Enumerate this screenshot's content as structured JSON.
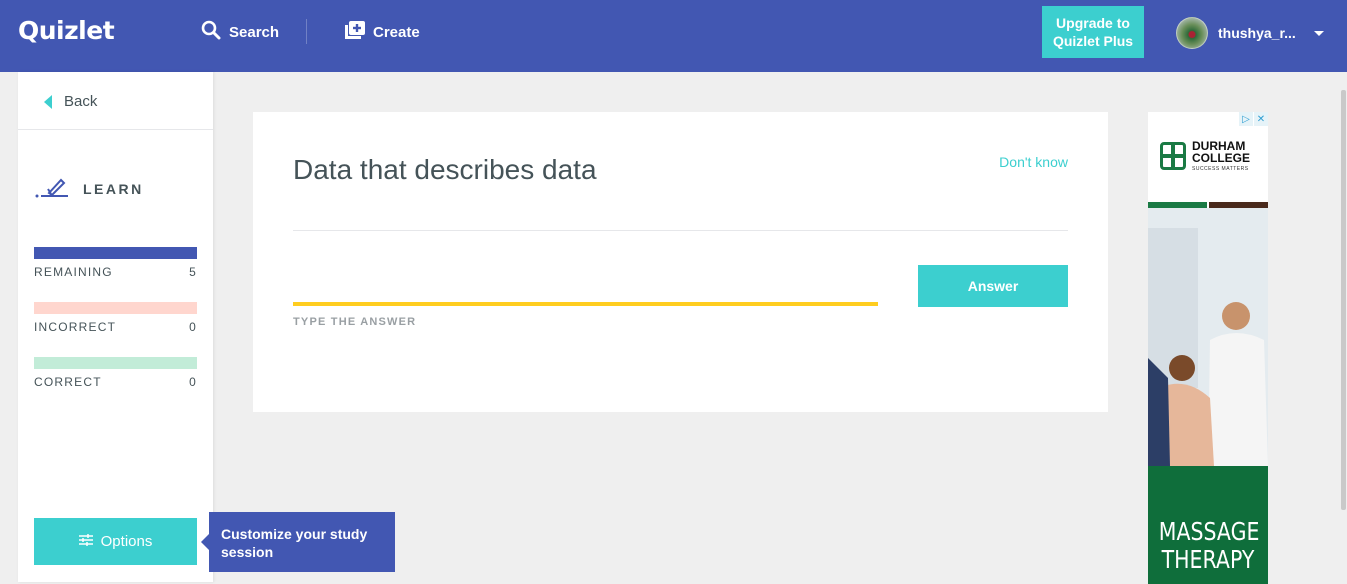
{
  "header": {
    "logo": "Quizlet",
    "search_label": "Search",
    "create_label": "Create",
    "upgrade_label": "Upgrade to\nQuizlet Plus",
    "username": "thushya_r..."
  },
  "sidebar": {
    "back_label": "Back",
    "mode_label": "LEARN",
    "stats": [
      {
        "label": "REMAINING",
        "value": "5",
        "color": "#4257b2"
      },
      {
        "label": "INCORRECT",
        "value": "0",
        "color": "#ffd6ce"
      },
      {
        "label": "CORRECT",
        "value": "0",
        "color": "#c2ecd8"
      }
    ],
    "options_label": "Options"
  },
  "tooltip": {
    "text": "Customize your study session"
  },
  "card": {
    "question": "Data that describes data",
    "dont_know": "Don't know",
    "answer_value": "",
    "input_label": "TYPE THE ANSWER",
    "answer_button": "Answer"
  },
  "ad": {
    "brand_line1": "DURHAM",
    "brand_line2": "COLLEGE",
    "tagline": "SUCCESS MATTERS",
    "headline_line1": "MASSAGE",
    "headline_line2": "THERAPY",
    "close_icons": [
      "ad-info-icon",
      "ad-close-icon"
    ]
  },
  "colors": {
    "brand": "#4257b2",
    "accent": "#3ccfcf",
    "input_underline": "#ffcd1f",
    "background": "#efefef"
  }
}
